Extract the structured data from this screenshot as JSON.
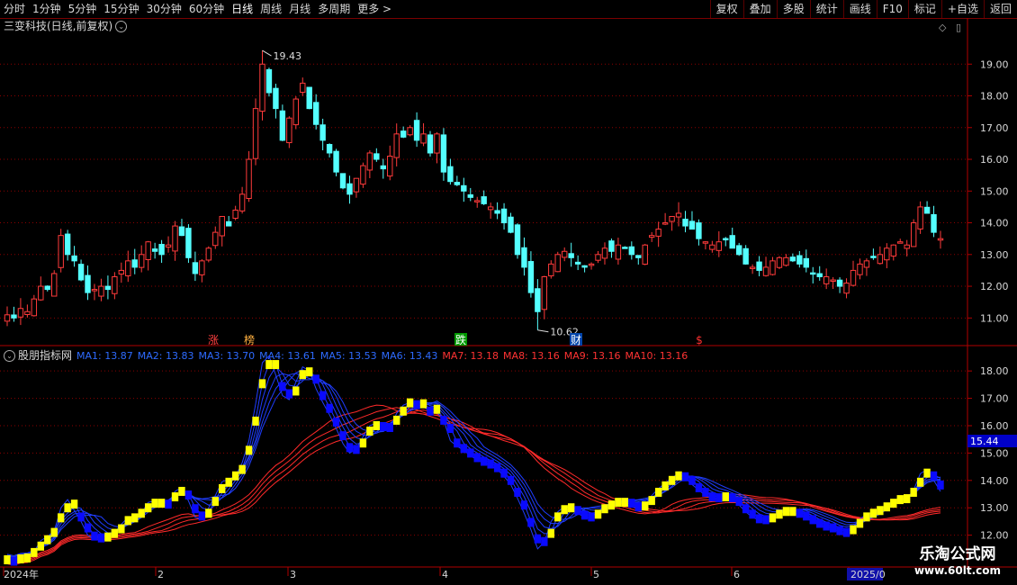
{
  "toolbar": {
    "left_items": [
      "分时",
      "1分钟",
      "5分钟",
      "15分钟",
      "30分钟",
      "60分钟",
      "日线",
      "周线",
      "月线",
      "多周期",
      "更多 >"
    ],
    "active_item": "日线",
    "right_items": [
      "复权",
      "叠加",
      "多股",
      "统计",
      "画线",
      "F10",
      "标记",
      "+自选",
      "返回"
    ]
  },
  "main_panel": {
    "title": "三变科技(日线,前复权)",
    "high_label": "19.43",
    "low_label": "10.62",
    "markers": [
      {
        "text": "涨",
        "color": "#ff4040",
        "date": "02-07"
      },
      {
        "text": "榜",
        "color": "#ffb040",
        "date": "02-21"
      },
      {
        "text": "跌",
        "color": "#ffffff",
        "bg": "#009900",
        "date": "04-08"
      },
      {
        "text": "财",
        "color": "#ffffff",
        "bg": "#0044aa",
        "date": "05-05"
      },
      {
        "text": "$",
        "color": "#ff3030",
        "date": "05-30"
      }
    ]
  },
  "indicator_panel": {
    "name": "股朋指标网",
    "ma_values": [
      {
        "label": "MA1: 13.87",
        "color": "#2e6bff"
      },
      {
        "label": "MA2: 13.83",
        "color": "#2e6bff"
      },
      {
        "label": "MA3: 13.70",
        "color": "#2e6bff"
      },
      {
        "label": "MA4: 13.61",
        "color": "#2e6bff"
      },
      {
        "label": "MA5: 13.53",
        "color": "#2e6bff"
      },
      {
        "label": "MA6: 13.43",
        "color": "#2e6bff"
      },
      {
        "label": "MA7: 13.18",
        "color": "#ff3333"
      },
      {
        "label": "MA8: 13.16",
        "color": "#ff3333"
      },
      {
        "label": "MA9: 13.16",
        "color": "#ff3333"
      },
      {
        "label": "MA10: 13.16",
        "color": "#ff3333"
      }
    ],
    "current_value": "15.44"
  },
  "x_axis_labels": [
    "2024年",
    "2",
    "3",
    "4",
    "5",
    "6",
    "2025/0"
  ],
  "watermark": {
    "line1": "乐淘公式网",
    "line2": "www.60lt.com"
  },
  "colors": {
    "up": "#ff3b3b",
    "down": "#54ffff",
    "grid": "#8b0000",
    "axis": "#b00000",
    "blue_band": "#0a0aff",
    "yellow_band": "#ffff00"
  },
  "chart_data": [
    {
      "type": "candlestick",
      "title": "三变科技(日线,前复权)",
      "y_ticks": [
        11.0,
        12.0,
        13.0,
        14.0,
        15.0,
        16.0,
        17.0,
        18.0,
        19.0
      ],
      "ylim": [
        10.3,
        20.0
      ],
      "x_months": [
        "2024年",
        "2",
        "3",
        "4",
        "5",
        "6",
        "2025/0"
      ],
      "max_label": 19.43,
      "min_label": 10.62,
      "close": [
        11.1,
        11.0,
        11.3,
        11.2,
        11.6,
        12.0,
        11.9,
        12.4,
        13.6,
        13.0,
        12.8,
        12.2,
        11.8,
        11.9,
        12.0,
        11.9,
        12.3,
        12.5,
        12.8,
        12.6,
        13.0,
        13.4,
        13.1,
        13.0,
        13.3,
        13.9,
        13.6,
        12.9,
        12.4,
        12.8,
        13.2,
        13.7,
        14.2,
        13.9,
        14.4,
        14.9,
        16.0,
        17.6,
        19.0,
        18.1,
        17.6,
        16.6,
        17.3,
        17.9,
        18.4,
        17.6,
        17.1,
        16.6,
        16.2,
        15.6,
        15.1,
        14.9,
        15.4,
        15.8,
        16.2,
        16.0,
        15.7,
        16.1,
        16.8,
        16.7,
        17.0,
        16.6,
        16.8,
        16.2,
        16.8,
        15.6,
        15.3,
        15.2,
        15.0,
        14.8,
        14.7,
        14.6,
        14.5,
        14.3,
        14.0,
        13.7,
        13.0,
        12.6,
        11.8,
        11.2,
        12.3,
        12.7,
        13.0,
        13.1,
        12.9,
        12.7,
        12.6,
        12.7,
        13.0,
        13.2,
        13.1,
        13.3,
        13.2,
        13.0,
        12.9,
        13.3,
        13.6,
        13.8,
        14.0,
        14.2,
        14.3,
        13.9,
        13.8,
        13.5,
        13.4,
        13.3,
        13.4,
        13.5,
        13.2,
        13.0,
        12.7,
        12.6,
        12.5,
        12.6,
        12.8,
        12.9,
        12.9,
        12.8,
        12.7,
        12.6,
        12.4,
        12.3,
        12.3,
        12.2,
        12.0,
        12.1,
        12.5,
        12.7,
        12.8,
        12.9,
        13.0,
        13.2,
        13.3,
        13.4,
        13.3,
        14.0,
        14.5,
        14.3,
        13.7,
        13.5
      ]
    },
    {
      "type": "line",
      "title": "股朋指标网",
      "y_ticks": [
        12.0,
        13.0,
        14.0,
        15.0,
        16.0,
        17.0,
        18.0
      ],
      "ylim": [
        11.1,
        18.4
      ],
      "series": [
        {
          "name": "MA1",
          "last": 13.87
        },
        {
          "name": "MA2",
          "last": 13.83
        },
        {
          "name": "MA3",
          "last": 13.7
        },
        {
          "name": "MA4",
          "last": 13.61
        },
        {
          "name": "MA5",
          "last": 13.53
        },
        {
          "name": "MA6",
          "last": 13.43
        },
        {
          "name": "MA7",
          "last": 13.18
        },
        {
          "name": "MA8",
          "last": 13.16
        },
        {
          "name": "MA9",
          "last": 13.16
        },
        {
          "name": "MA10",
          "last": 13.16
        }
      ]
    }
  ]
}
